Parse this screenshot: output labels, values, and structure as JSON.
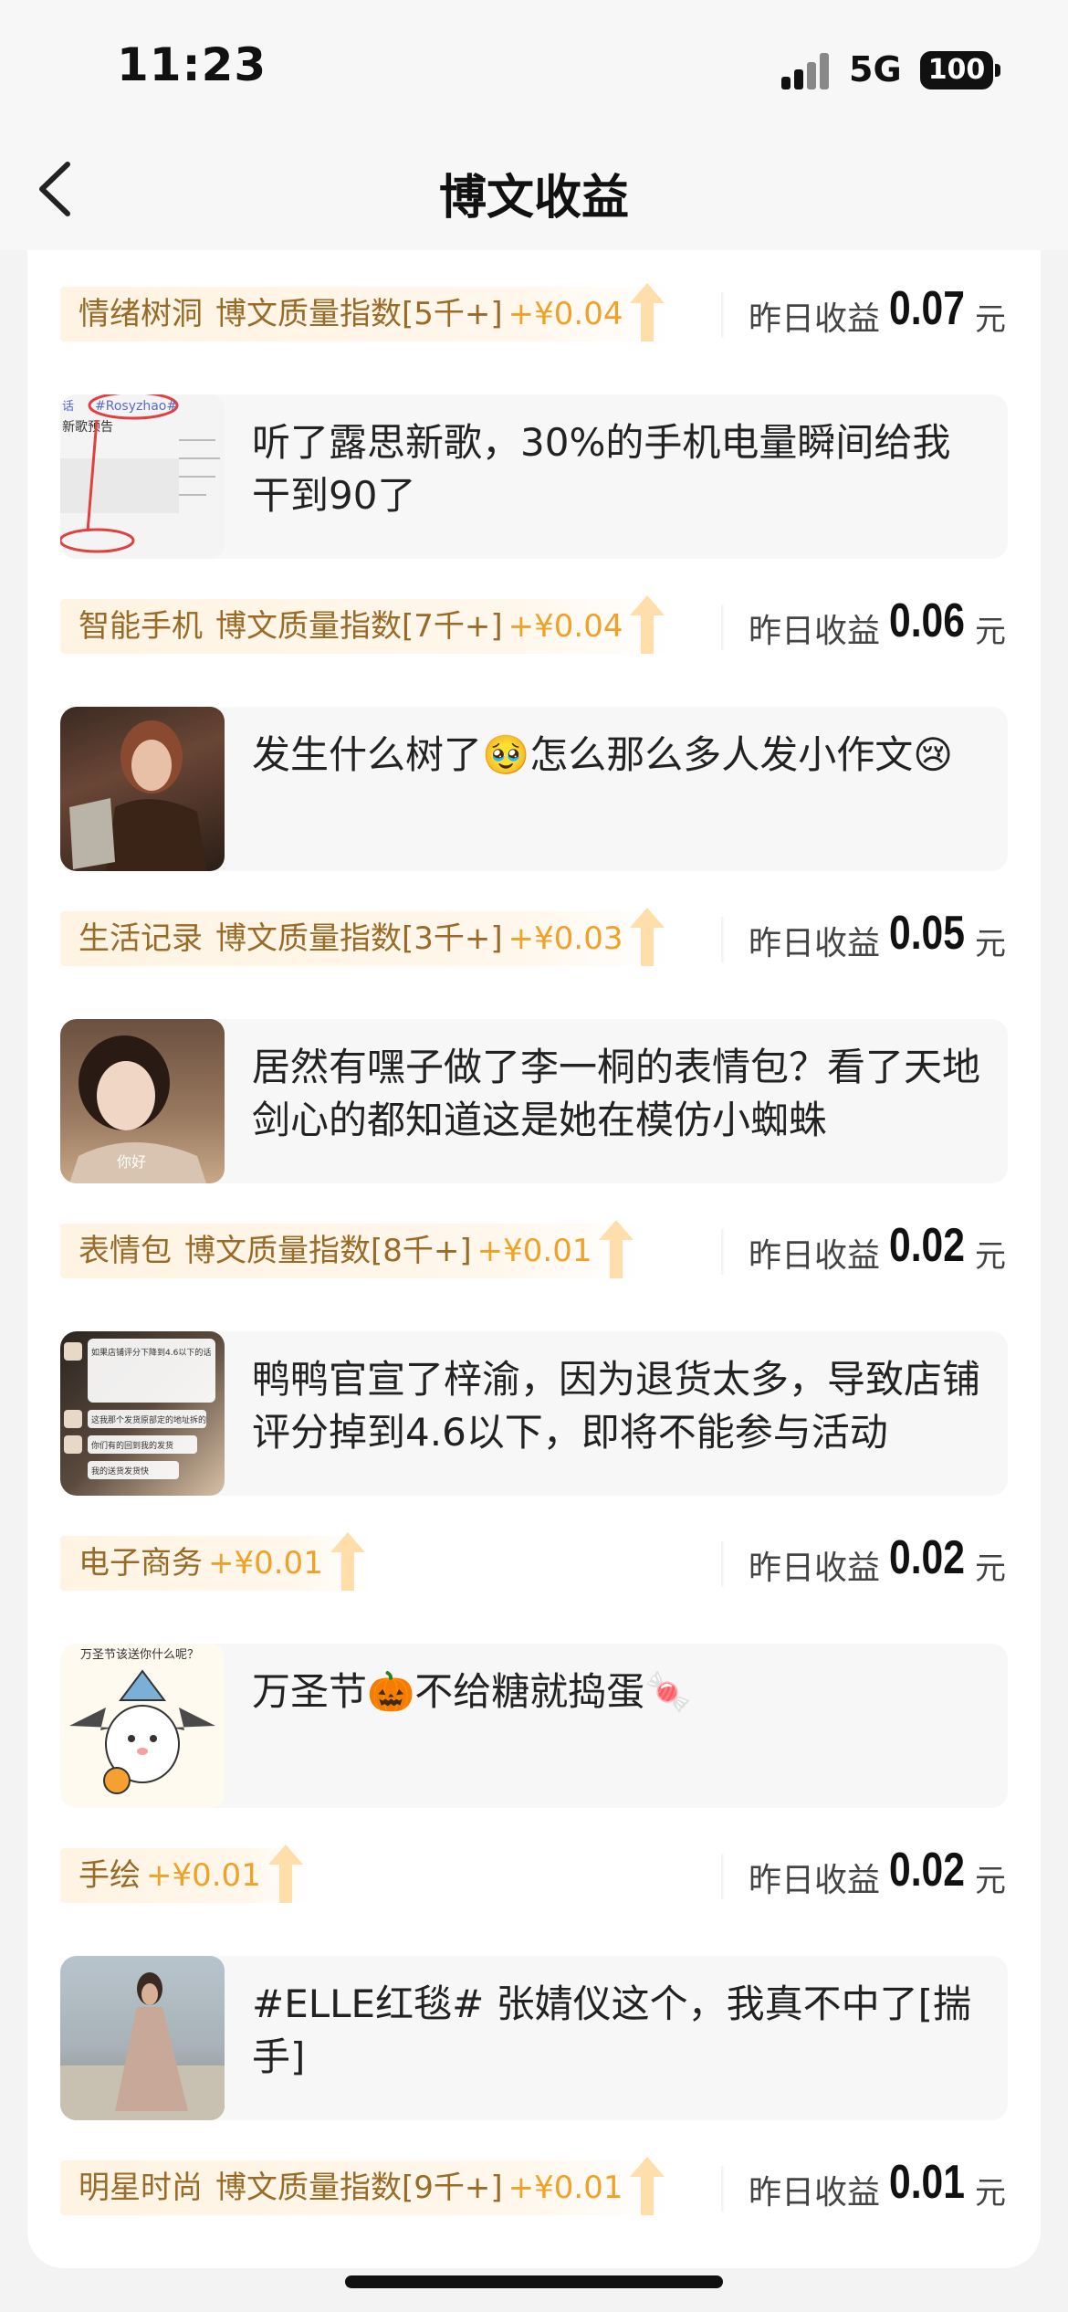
{
  "status_bar": {
    "time": "11:23",
    "network": "5G",
    "battery": "100"
  },
  "nav": {
    "title": "博文收益"
  },
  "earn_label": "昨日收益",
  "earn_unit": "元",
  "items": [
    {
      "post_text": "",
      "tag": "情绪树洞",
      "quality": "博文质量指数[5千+]",
      "bonus": "+¥0.04",
      "earning": "0.07"
    },
    {
      "post_text": "听了露思新歌，30%的手机电量瞬间给我干到90了",
      "tag": "智能手机",
      "quality": "博文质量指数[7千+]",
      "bonus": "+¥0.04",
      "earning": "0.06"
    },
    {
      "post_text": "发生什么树了🥹怎么那么多人发小作文😢",
      "tag": "生活记录",
      "quality": "博文质量指数[3千+]",
      "bonus": "+¥0.03",
      "earning": "0.05"
    },
    {
      "post_text": "居然有嘿子做了李一桐的表情包？看了天地剑心的都知道这是她在模仿小蜘蛛",
      "tag": "表情包",
      "quality": "博文质量指数[8千+]",
      "bonus": "+¥0.01",
      "earning": "0.02"
    },
    {
      "post_text": "鸭鸭官宣了梓渝，因为退货太多，导致店铺评分掉到4.6以下，即将不能参与活动",
      "tag": "电子商务",
      "quality": "",
      "bonus": "+¥0.01",
      "earning": "0.02"
    },
    {
      "post_text": "万圣节🎃不给糖就捣蛋🍬",
      "tag": "手绘",
      "quality": "",
      "bonus": "+¥0.01",
      "earning": "0.02"
    },
    {
      "post_text": "#ELLE红毯# 张婧仪这个，我真不中了[揣手]",
      "tag": "明星时尚",
      "quality": "博文质量指数[9千+]",
      "bonus": "+¥0.01",
      "earning": "0.01"
    }
  ],
  "thumbs": {
    "t1": {
      "hashtag": "#Rosyzhao#",
      "label": "新歌预告",
      "side": "话"
    },
    "t2": {
      "caption": ""
    },
    "t3": {
      "caption": "你好"
    },
    "t4": {
      "line1": "如果店铺评分下降到4.6以下的话",
      "line2": "这我那个发货原部定的地址拆的",
      "line3": "你们有的回到我的发货",
      "line4": "我的送货发货快"
    },
    "t5": {
      "title": "万圣节该送你什么呢？"
    }
  },
  "colors": {
    "accent_orange": "#f0a128",
    "tag_text": "#9a6a28",
    "tag_bg": "#fff4e3",
    "card_bg": "#ffffff",
    "page_bg": "#f3f3f3"
  }
}
